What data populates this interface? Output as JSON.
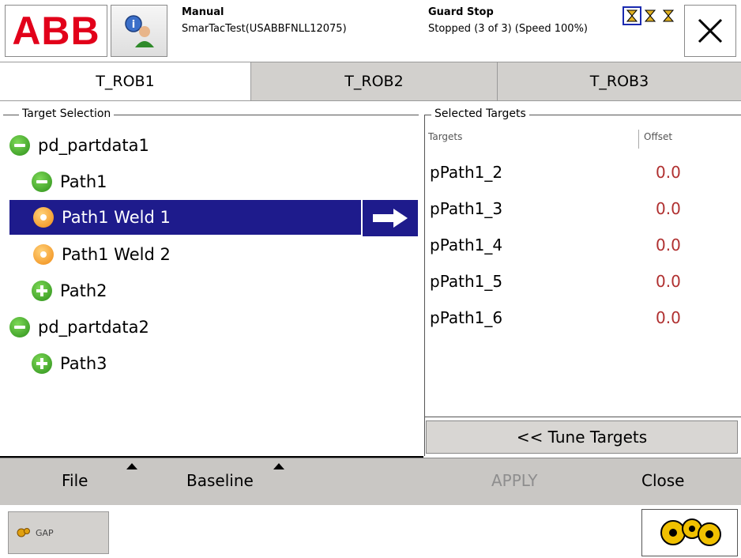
{
  "header": {
    "logo_text": "ABB",
    "mode_label": "Manual",
    "system_name": "SmarTacTest(USABBFNLL12075)",
    "guard_label": "Guard Stop",
    "run_status": "Stopped (3 of 3) (Speed 100%)"
  },
  "tabs": [
    {
      "label": "T_ROB1"
    },
    {
      "label": "T_ROB2"
    },
    {
      "label": "T_ROB3"
    }
  ],
  "target_selection": {
    "legend": "Target Selection",
    "items": [
      {
        "label": "pd_partdata1",
        "icon": "minus-circle-icon"
      },
      {
        "label": "Path1",
        "icon": "minus-circle-icon"
      },
      {
        "label": "Path1 Weld 1",
        "icon": "orange-dot-icon",
        "selected": true
      },
      {
        "label": "Path1 Weld 2",
        "icon": "orange-dot-icon"
      },
      {
        "label": "Path2",
        "icon": "plus-circle-icon"
      },
      {
        "label": "pd_partdata2",
        "icon": "minus-circle-icon"
      },
      {
        "label": "Path3",
        "icon": "plus-circle-icon"
      }
    ]
  },
  "selected_targets": {
    "legend": "Selected Targets",
    "col_targets": "Targets",
    "col_offset": "Offset",
    "rows": [
      {
        "name": "pPath1_2",
        "offset": "0.0"
      },
      {
        "name": "pPath1_3",
        "offset": "0.0"
      },
      {
        "name": "pPath1_4",
        "offset": "0.0"
      },
      {
        "name": "pPath1_5",
        "offset": "0.0"
      },
      {
        "name": "pPath1_6",
        "offset": "0.0"
      }
    ],
    "tune_button": "<< Tune Targets"
  },
  "commands": {
    "file": "File",
    "baseline": "Baseline",
    "apply": "APPLY",
    "close": "Close"
  },
  "taskbar": {
    "app_label": "GAP"
  },
  "colors": {
    "selection": "#1e1b8c",
    "offset_text": "#b03030",
    "logo_red": "#e2001a",
    "bar_gray": "#c9c7c4"
  }
}
